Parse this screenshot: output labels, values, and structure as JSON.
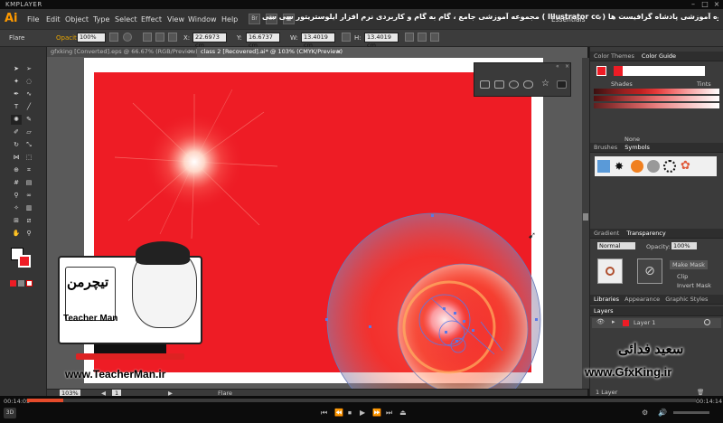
{
  "player": {
    "name": "KMPLAYER",
    "time_elapsed": "00:14:05",
    "time_total": "00:14:14"
  },
  "app": {
    "logo": "Ai",
    "menus": [
      "File",
      "Edit",
      "Object",
      "Type",
      "Select",
      "Effect",
      "View",
      "Window",
      "Help"
    ],
    "bridge_icon": "Br",
    "stock_icon": "St",
    "course_title": "مجموعه آموزشی جامع ، گام به گام و کاربردی نرم افزار ایلوستریتور سی سی ( Illustrator cc )   مدرس : سعید فدایی ( تیچرمن ) گروه آموزشی پادشاه گرافیست ها",
    "workspace": "Essentials"
  },
  "control": {
    "selection": "Flare",
    "opacity_label": "Opacity:",
    "opacity_value": "100%",
    "x_label": "X:",
    "x_value": "22.6973 cm",
    "y_label": "Y:",
    "y_value": "16.6737 cm",
    "w_label": "W:",
    "w_value": "13.4019 cm",
    "h_label": "H:",
    "h_value": "13.4019 cm"
  },
  "tabs": [
    {
      "label": "gfxking [Converted].eps @ 66.67% (RGB/Preview)"
    },
    {
      "label": "class 2 [Recovered].ai* @ 103% (CMYK/Preview)"
    }
  ],
  "status": {
    "zoom": "103%",
    "page": "1",
    "tool": "Flare"
  },
  "panels": {
    "color_tabs": [
      "Color Themes",
      "Color Guide"
    ],
    "shades": "Shades",
    "tints": "Tints",
    "none": "None",
    "brush_tabs": [
      "Brushes",
      "Symbols"
    ],
    "gradient_tabs": [
      "Gradient",
      "Transparency"
    ],
    "blend_mode": "Normal",
    "opacity_label": "Opacity:",
    "opacity_value": "100%",
    "make_mask": "Make Mask",
    "clip": "Clip",
    "invert_mask": "Invert Mask",
    "lib_tabs": [
      "Libraries",
      "Appearance",
      "Graphic Styles"
    ],
    "layers_tab": "Layers",
    "layer_name": "Layer 1",
    "layers_count": "1 Layer"
  },
  "watermark": {
    "brand_fa": "تیچرمن",
    "brand_en": "Teacher Man",
    "site_left": "www.TeacherMan.ir",
    "name_fa": "سعید فدائی",
    "site_right": "www.GfxKing.ir"
  },
  "colors": {
    "artboard": "#ee1c25",
    "accent": "#ff9a00",
    "progress": "#e64b2b"
  }
}
